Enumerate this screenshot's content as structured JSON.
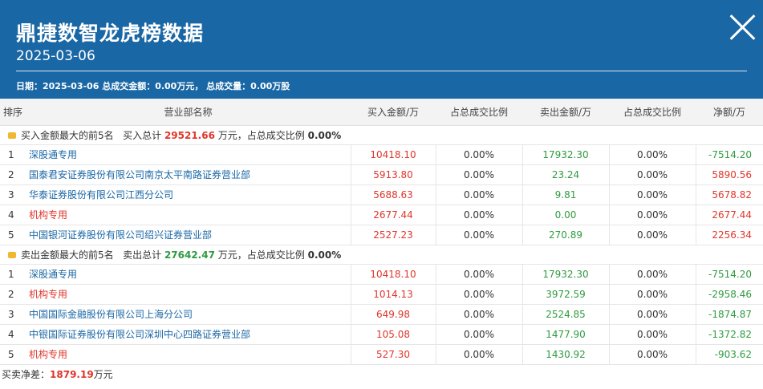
{
  "header": {
    "title": "鼎捷数智龙虎榜数据",
    "date": "2025-03-06",
    "summary": "日期：2025-03-06 总成交金额：0.00万元， 总成交量：0.00万股"
  },
  "columns": [
    "排序",
    "营业部名称",
    "买入金额/万",
    "占总成交比例",
    "卖出金额/万",
    "占总成交比例",
    "净额/万"
  ],
  "buy_section": {
    "label": "买入金额最大的前5名",
    "total_label": "买入总计",
    "total": "29521.66",
    "unit_ratio_label": "万元，占总成交比例",
    "ratio": "0.00%"
  },
  "buy_rows": [
    {
      "rank": "1",
      "name": "深股通专用",
      "name_color": "blue",
      "buy": "10418.10",
      "buy_ratio": "0.00%",
      "sell": "17932.30",
      "sell_ratio": "0.00%",
      "net": "-7514.20",
      "net_color": "green"
    },
    {
      "rank": "2",
      "name": "国泰君安证券股份有限公司南京太平南路证券营业部",
      "name_color": "blue",
      "buy": "5913.80",
      "buy_ratio": "0.00%",
      "sell": "23.24",
      "sell_ratio": "0.00%",
      "net": "5890.56",
      "net_color": "red"
    },
    {
      "rank": "3",
      "name": "华泰证券股份有限公司江西分公司",
      "name_color": "blue",
      "buy": "5688.63",
      "buy_ratio": "0.00%",
      "sell": "9.81",
      "sell_ratio": "0.00%",
      "net": "5678.82",
      "net_color": "red"
    },
    {
      "rank": "4",
      "name": "机构专用",
      "name_color": "red",
      "buy": "2677.44",
      "buy_ratio": "0.00%",
      "sell": "0.00",
      "sell_ratio": "0.00%",
      "net": "2677.44",
      "net_color": "red"
    },
    {
      "rank": "5",
      "name": "中国银河证券股份有限公司绍兴证券营业部",
      "name_color": "blue",
      "buy": "2527.23",
      "buy_ratio": "0.00%",
      "sell": "270.89",
      "sell_ratio": "0.00%",
      "net": "2256.34",
      "net_color": "red"
    }
  ],
  "sell_section": {
    "label": "卖出金额最大的前5名",
    "total_label": "卖出总计",
    "total": "27642.47",
    "unit_ratio_label": "万元，占总成交比例",
    "ratio": "0.00%"
  },
  "sell_rows": [
    {
      "rank": "1",
      "name": "深股通专用",
      "name_color": "blue",
      "buy": "10418.10",
      "buy_ratio": "0.00%",
      "sell": "17932.30",
      "sell_ratio": "0.00%",
      "net": "-7514.20",
      "net_color": "green"
    },
    {
      "rank": "2",
      "name": "机构专用",
      "name_color": "red",
      "buy": "1014.13",
      "buy_ratio": "0.00%",
      "sell": "3972.59",
      "sell_ratio": "0.00%",
      "net": "-2958.46",
      "net_color": "green"
    },
    {
      "rank": "3",
      "name": "中国国际金融股份有限公司上海分公司",
      "name_color": "blue",
      "buy": "649.98",
      "buy_ratio": "0.00%",
      "sell": "2524.85",
      "sell_ratio": "0.00%",
      "net": "-1874.87",
      "net_color": "green"
    },
    {
      "rank": "4",
      "name": "中银国际证券股份有限公司深圳中心四路证券营业部",
      "name_color": "blue",
      "buy": "105.08",
      "buy_ratio": "0.00%",
      "sell": "1477.90",
      "sell_ratio": "0.00%",
      "net": "-1372.82",
      "net_color": "green"
    },
    {
      "rank": "5",
      "name": "机构专用",
      "name_color": "red",
      "buy": "527.30",
      "buy_ratio": "0.00%",
      "sell": "1430.92",
      "sell_ratio": "0.00%",
      "net": "-903.62",
      "net_color": "green"
    }
  ],
  "footer": {
    "label": "买卖净差：",
    "value": "1879.19",
    "unit": "万元"
  },
  "colors": {
    "header_bg": "#1a67a5",
    "red": "#e0352b",
    "green": "#2e9b3f",
    "blue": "#1a67a5"
  }
}
